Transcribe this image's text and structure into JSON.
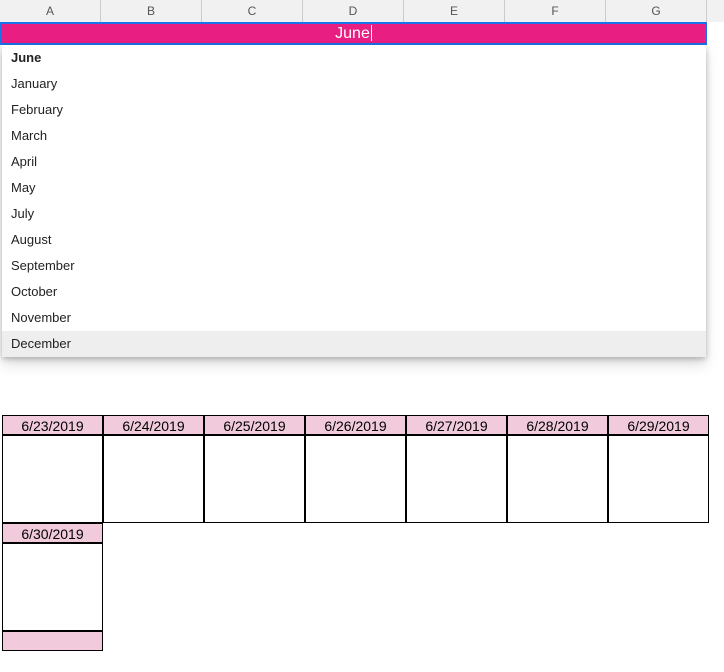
{
  "columns": [
    "A",
    "B",
    "C",
    "D",
    "E",
    "F",
    "G"
  ],
  "title_cell": {
    "value": "June",
    "bg_color": "#e91e83",
    "text_color": "#ffffff",
    "selection_border": "#1a73e8"
  },
  "dropdown": {
    "items": [
      {
        "label": "June",
        "selected": true,
        "highlight": false
      },
      {
        "label": "January",
        "selected": false,
        "highlight": false
      },
      {
        "label": "February",
        "selected": false,
        "highlight": false
      },
      {
        "label": "March",
        "selected": false,
        "highlight": false
      },
      {
        "label": "April",
        "selected": false,
        "highlight": false
      },
      {
        "label": "May",
        "selected": false,
        "highlight": false
      },
      {
        "label": "July",
        "selected": false,
        "highlight": false
      },
      {
        "label": "August",
        "selected": false,
        "highlight": false
      },
      {
        "label": "September",
        "selected": false,
        "highlight": false
      },
      {
        "label": "October",
        "selected": false,
        "highlight": false
      },
      {
        "label": "November",
        "selected": false,
        "highlight": false
      },
      {
        "label": "December",
        "selected": false,
        "highlight": true
      }
    ]
  },
  "calendar": {
    "header_bg": "#f1cbdc",
    "rows": [
      {
        "dates": [
          "6/23/2019",
          "6/24/2019",
          "6/25/2019",
          "6/26/2019",
          "6/27/2019",
          "6/28/2019",
          "6/29/2019"
        ]
      },
      {
        "dates": [
          "6/30/2019",
          "",
          "",
          "",
          "",
          "",
          ""
        ]
      }
    ]
  }
}
